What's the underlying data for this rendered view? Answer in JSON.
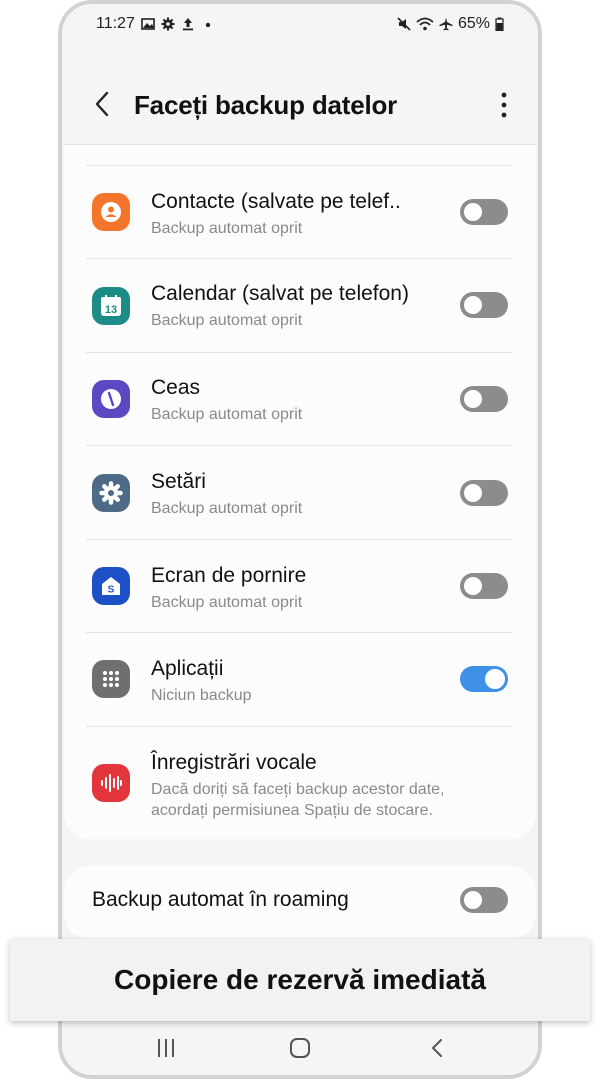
{
  "status_bar": {
    "time": "11:27",
    "battery": "65%"
  },
  "header": {
    "title": "Faceți backup datelor"
  },
  "items": [
    {
      "label": "Contacte (salvate pe telef..",
      "sub": "Backup automat oprit",
      "icon": "contacts-icon",
      "color": "#f2752b",
      "toggle": false
    },
    {
      "label": "Calendar (salvat pe telefon)",
      "sub": "Backup automat oprit",
      "icon": "calendar-icon",
      "color": "#1e8c86",
      "icon_text": "13",
      "toggle": false
    },
    {
      "label": "Ceas",
      "sub": "Backup automat oprit",
      "icon": "clock-icon",
      "color": "#5a49c2",
      "toggle": false
    },
    {
      "label": "Setări",
      "sub": "Backup automat oprit",
      "icon": "settings-gear-icon",
      "color": "#4d6a86",
      "toggle": false
    },
    {
      "label": "Ecran de pornire",
      "sub": "Backup automat oprit",
      "icon": "home-screen-icon",
      "color": "#1d50c7",
      "icon_text": "S",
      "toggle": false
    },
    {
      "label": "Aplicații",
      "sub": "Niciun backup",
      "icon": "apps-grid-icon",
      "color": "#6f6f6f",
      "toggle": true
    },
    {
      "label": "Înregistrări vocale",
      "sub1": "Dacă doriți să faceți backup acestor date,",
      "sub2": "acordați permisiunea Spațiu de stocare.",
      "icon": "voice-recorder-icon",
      "color": "#e2363c"
    }
  ],
  "roaming": {
    "label": "Backup automat în roaming",
    "toggle": false
  },
  "overlay_button": {
    "label": "Copiere de rezervă imediată"
  },
  "colors": {
    "toggle_on": "#3e91e6",
    "toggle_off": "#8c8c8c"
  }
}
